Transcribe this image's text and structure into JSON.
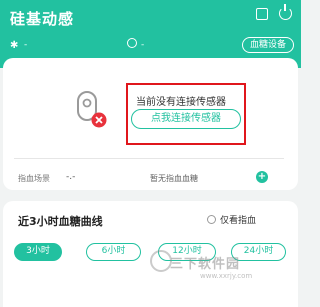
{
  "header": {
    "title": "硅基动感",
    "bluetooth_value": "-",
    "clock_value": "-",
    "settings_label": "血糖设备"
  },
  "sensor": {
    "status_text": "当前没有连接传感器",
    "connect_label": "点我连接传感器"
  },
  "scene": {
    "label": "指血场景",
    "value": "-.-",
    "empty_text": "暂无指血血糖",
    "add_symbol": "+"
  },
  "curve": {
    "title": "近3小时血糖曲线",
    "radio_label": "仅看指血",
    "tabs": [
      {
        "label": "3小时",
        "active": true
      },
      {
        "label": "6小时",
        "active": false
      },
      {
        "label": "12小时",
        "active": false
      },
      {
        "label": "24小时",
        "active": false
      }
    ]
  },
  "watermark": {
    "text": "三下软件园",
    "url": "www.xxrjy.com"
  },
  "colors": {
    "accent": "#22c1a0",
    "alert_red": "#e0161c",
    "error_red": "#e8323c"
  }
}
